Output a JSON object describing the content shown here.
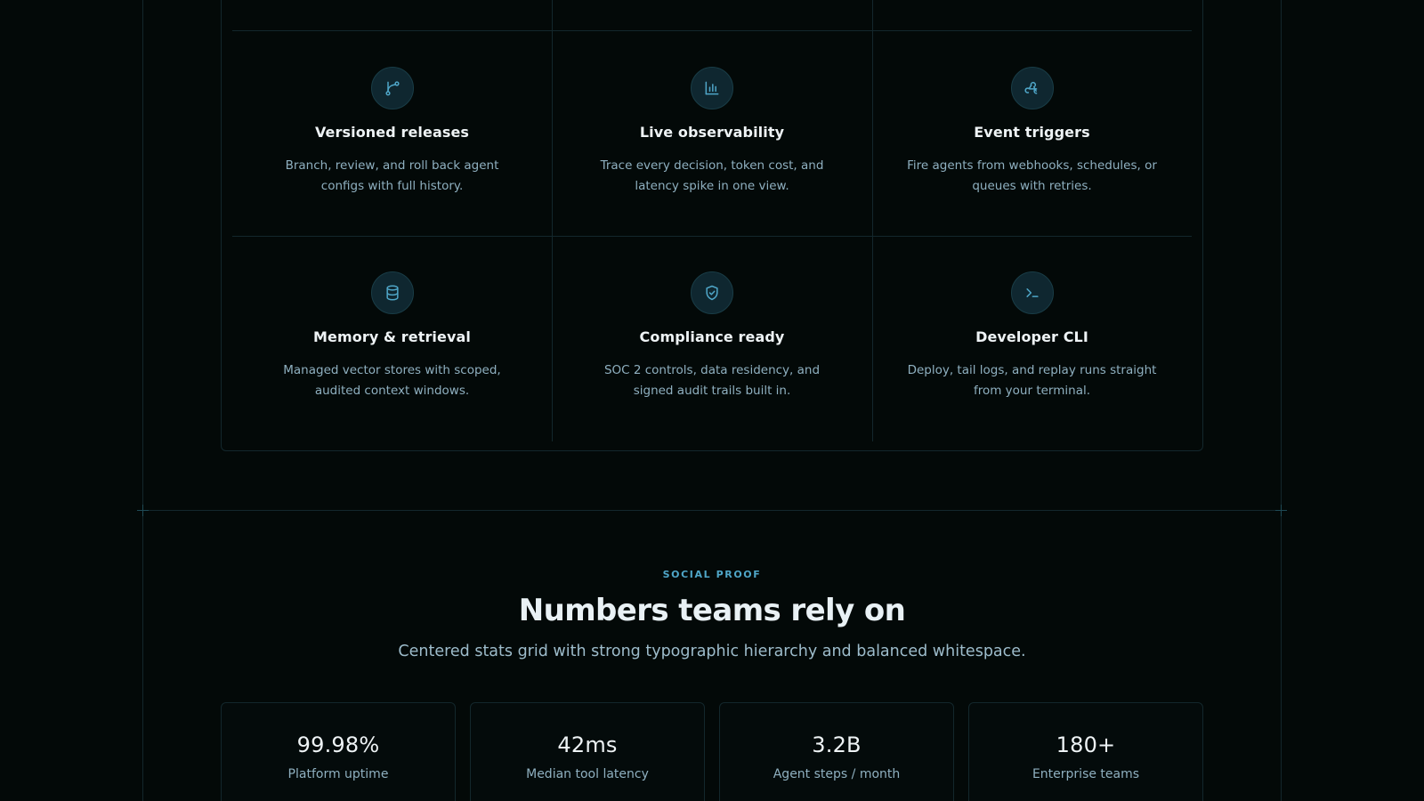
{
  "features": [
    {
      "icon": "git-branch-icon",
      "title": "Versioned releases",
      "description": "Branch, review, and roll back agent configs with full history."
    },
    {
      "icon": "bar-chart-icon",
      "title": "Live observability",
      "description": "Trace every decision, token cost, and latency spike in one view."
    },
    {
      "icon": "webhook-icon",
      "title": "Event triggers",
      "description": "Fire agents from webhooks, schedules, or queues with retries."
    },
    {
      "icon": "database-icon",
      "title": "Memory & retrieval",
      "description": "Managed vector stores with scoped, audited context windows."
    },
    {
      "icon": "shield-check-icon",
      "title": "Compliance ready",
      "description": "SOC 2 controls, data residency, and signed audit trails built in."
    },
    {
      "icon": "terminal-icon",
      "title": "Developer CLI",
      "description": "Deploy, tail logs, and replay runs straight from your terminal."
    }
  ],
  "social_proof": {
    "eyebrow": "SOCIAL PROOF",
    "title": "Numbers teams rely on",
    "subtitle": "Centered stats grid with strong typographic hierarchy and balanced whitespace.",
    "stats": [
      {
        "value": "99.98%",
        "label": "Platform uptime"
      },
      {
        "value": "42ms",
        "label": "Median tool latency"
      },
      {
        "value": "3.2B",
        "label": "Agent steps / month"
      },
      {
        "value": "180+",
        "label": "Enterprise teams"
      }
    ]
  },
  "colors": {
    "background": "#030908",
    "accent": "#4fa6c8",
    "border": "#13272c"
  }
}
